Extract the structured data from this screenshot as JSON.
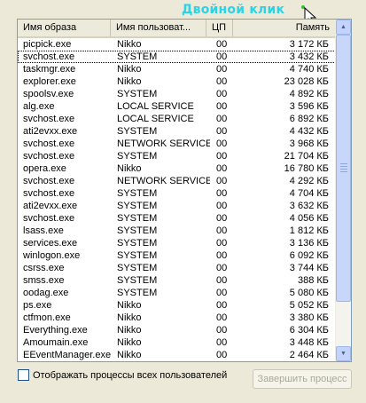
{
  "annotation": "Двойной клик",
  "columns": {
    "name": "Имя образа",
    "user": "Имя пользоват...",
    "cpu": "ЦП",
    "mem": "Память"
  },
  "rows": [
    {
      "name": "picpick.exe",
      "user": "Nikko",
      "cpu": "00",
      "mem": "3 172 КБ"
    },
    {
      "name": "svchost.exe",
      "user": "SYSTEM",
      "cpu": "00",
      "mem": "3 432 КБ"
    },
    {
      "name": "taskmgr.exe",
      "user": "Nikko",
      "cpu": "00",
      "mem": "4 740 КБ"
    },
    {
      "name": "explorer.exe",
      "user": "Nikko",
      "cpu": "00",
      "mem": "23 028 КБ"
    },
    {
      "name": "spoolsv.exe",
      "user": "SYSTEM",
      "cpu": "00",
      "mem": "4 892 КБ"
    },
    {
      "name": "alg.exe",
      "user": "LOCAL SERVICE",
      "cpu": "00",
      "mem": "3 596 КБ"
    },
    {
      "name": "svchost.exe",
      "user": "LOCAL SERVICE",
      "cpu": "00",
      "mem": "6 892 КБ"
    },
    {
      "name": "ati2evxx.exe",
      "user": "SYSTEM",
      "cpu": "00",
      "mem": "4 432 КБ"
    },
    {
      "name": "svchost.exe",
      "user": "NETWORK SERVICE",
      "cpu": "00",
      "mem": "3 968 КБ"
    },
    {
      "name": "svchost.exe",
      "user": "SYSTEM",
      "cpu": "00",
      "mem": "21 704 КБ"
    },
    {
      "name": "opera.exe",
      "user": "Nikko",
      "cpu": "00",
      "mem": "16 780 КБ"
    },
    {
      "name": "svchost.exe",
      "user": "NETWORK SERVICE",
      "cpu": "00",
      "mem": "4 292 КБ"
    },
    {
      "name": "svchost.exe",
      "user": "SYSTEM",
      "cpu": "00",
      "mem": "4 704 КБ"
    },
    {
      "name": "ati2evxx.exe",
      "user": "SYSTEM",
      "cpu": "00",
      "mem": "3 632 КБ"
    },
    {
      "name": "svchost.exe",
      "user": "SYSTEM",
      "cpu": "00",
      "mem": "4 056 КБ"
    },
    {
      "name": "lsass.exe",
      "user": "SYSTEM",
      "cpu": "00",
      "mem": "1 812 КБ"
    },
    {
      "name": "services.exe",
      "user": "SYSTEM",
      "cpu": "00",
      "mem": "3 136 КБ"
    },
    {
      "name": "winlogon.exe",
      "user": "SYSTEM",
      "cpu": "00",
      "mem": "6 092 КБ"
    },
    {
      "name": "csrss.exe",
      "user": "SYSTEM",
      "cpu": "00",
      "mem": "3 744 КБ"
    },
    {
      "name": "smss.exe",
      "user": "SYSTEM",
      "cpu": "00",
      "mem": "388 КБ"
    },
    {
      "name": "oodag.exe",
      "user": "SYSTEM",
      "cpu": "00",
      "mem": "5 080 КБ"
    },
    {
      "name": "ps.exe",
      "user": "Nikko",
      "cpu": "00",
      "mem": "5 052 КБ"
    },
    {
      "name": "ctfmon.exe",
      "user": "Nikko",
      "cpu": "00",
      "mem": "3 380 КБ"
    },
    {
      "name": "Everything.exe",
      "user": "Nikko",
      "cpu": "00",
      "mem": "6 304 КБ"
    },
    {
      "name": "Amoumain.exe",
      "user": "Nikko",
      "cpu": "00",
      "mem": "3 448 КБ"
    },
    {
      "name": "EEventManager.exe",
      "user": "Nikko",
      "cpu": "00",
      "mem": "2 464 КБ"
    }
  ],
  "selected_row_number": 2,
  "show_all_users_label": "Отображать процессы всех пользователей",
  "end_process_label": "Завершить процесс",
  "colors": {
    "annotation": "#2BD3E8",
    "window": "#ECE9D8",
    "border": "#7F9DB9"
  }
}
